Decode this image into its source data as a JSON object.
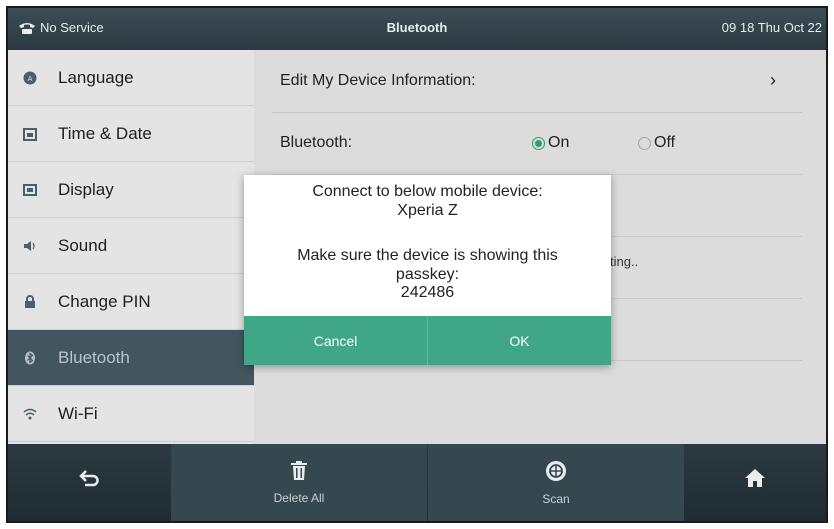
{
  "status_bar": {
    "service": "No Service",
    "title": "Bluetooth",
    "datetime": "09 18 Thu Oct 22"
  },
  "sidebar": {
    "items": [
      {
        "label": "Language",
        "icon": "globe-icon"
      },
      {
        "label": "Time & Date",
        "icon": "calendar-icon"
      },
      {
        "label": "Display",
        "icon": "display-icon"
      },
      {
        "label": "Sound",
        "icon": "speaker-icon"
      },
      {
        "label": "Change PIN",
        "icon": "lock-icon"
      },
      {
        "label": "Bluetooth",
        "icon": "bluetooth-icon",
        "active": true
      },
      {
        "label": "Wi-Fi",
        "icon": "wifi-icon"
      }
    ]
  },
  "content": {
    "edit_device_label": "Edit My Device Information:",
    "bluetooth_label": "Bluetooth:",
    "radio_on": "On",
    "radio_off": "Off",
    "bluetooth_state": "On",
    "partial_status": "ting.."
  },
  "dialog": {
    "line1": "Connect to below mobile device:",
    "device": "Xperia Z",
    "line2": "Make sure the device is showing this",
    "line3": "passkey:",
    "passkey": "242486",
    "cancel": "Cancel",
    "ok": "OK"
  },
  "bottom_bar": {
    "delete_all": "Delete All",
    "scan": "Scan"
  },
  "colors": {
    "accent": "#3fa686",
    "header": "#33444b",
    "sidebar_active": "#43565f"
  }
}
